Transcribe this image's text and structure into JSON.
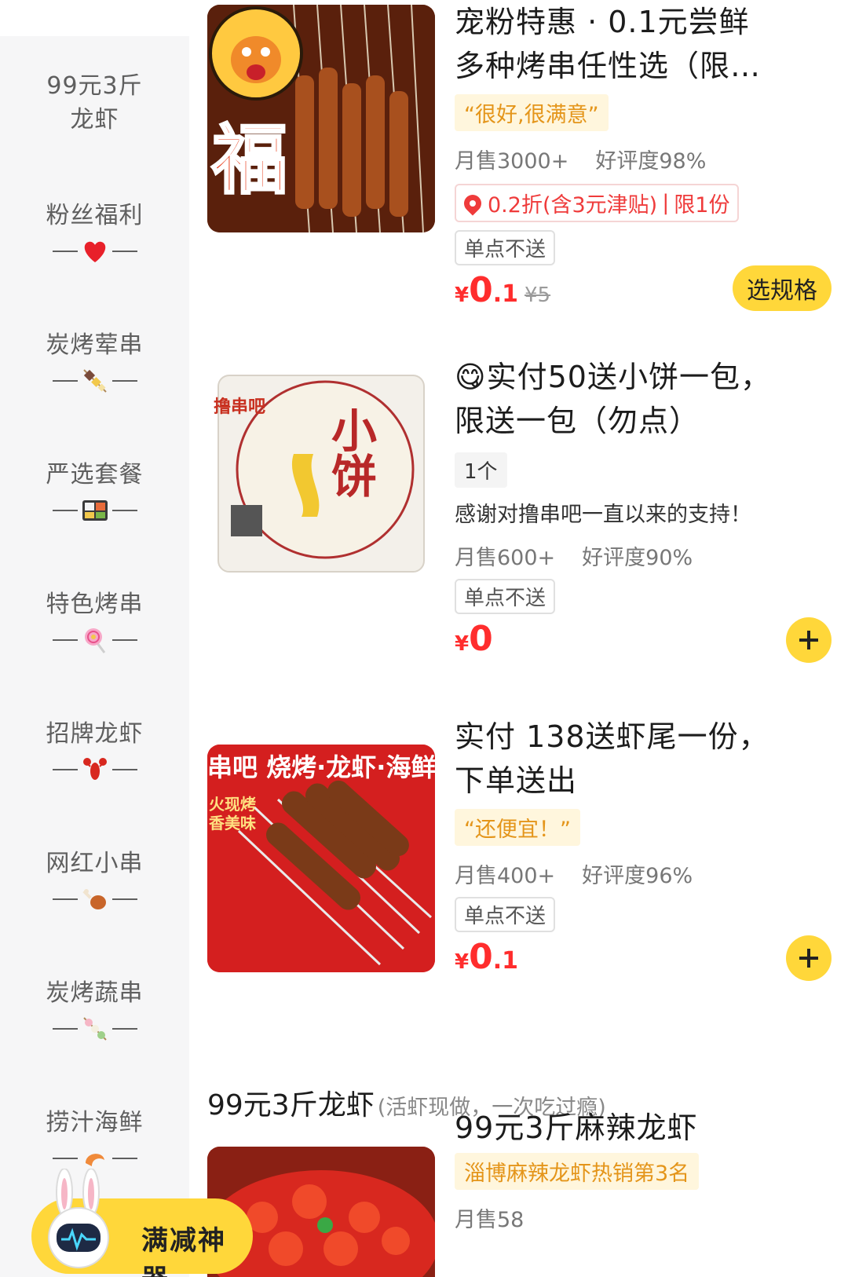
{
  "sidebar": {
    "items": [
      {
        "label_line1": "99元3斤",
        "label_line2": "龙虾",
        "icon": "none"
      },
      {
        "label": "粉丝福利",
        "icon": "heart-icon"
      },
      {
        "label": "炭烤荤串",
        "icon": "meat-skewer-icon"
      },
      {
        "label": "严选套餐",
        "icon": "bento-box-icon"
      },
      {
        "label": "特色烤串",
        "icon": "lollipop-icon"
      },
      {
        "label": "招牌龙虾",
        "icon": "lobster-icon"
      },
      {
        "label": "网红小串",
        "icon": "drumstick-icon"
      },
      {
        "label": "炭烤蔬串",
        "icon": "dango-icon"
      },
      {
        "label": "捞汁海鲜",
        "icon": "shrimp-icon"
      }
    ]
  },
  "products": [
    {
      "title_line1": "宠粉特惠 · 0.1元尝鲜",
      "title_line2": "多种烤串任性选（限…",
      "quote": "“很好,很满意”",
      "monthly_sales": "月售3000+",
      "rating": "好评度98%",
      "promo_discount": "0.2折(含3元津贴)",
      "promo_limit": "限1份",
      "no_delivery": "单点不送",
      "price_currency": "¥",
      "price_int": "0",
      "price_dec": ".1",
      "old_price": "¥5",
      "action": "选规格",
      "image_text": "福"
    },
    {
      "title_line1": "😋实付50送小饼一包，",
      "title_line2": "限送一包（勿点）",
      "unit": "1个",
      "description": "感谢对撸串吧一直以来的支持！",
      "monthly_sales": "月售600+",
      "rating": "好评度90%",
      "no_delivery": "单点不送",
      "price_currency": "¥",
      "price_int": "0",
      "image_brand": "撸串吧",
      "image_text": "小饼"
    },
    {
      "title_line1": "实付 138送虾尾一份，",
      "title_line2": "下单送出",
      "quote": "“还便宜！”",
      "monthly_sales": "月售400+",
      "rating": "好评度96%",
      "no_delivery": "单点不送",
      "price_currency": "¥",
      "price_int": "0",
      "price_dec": ".1",
      "image_banner": "串吧 烧烤·龙虾·海鲜",
      "image_sub": "火现烤 香美味"
    },
    {
      "title": "99元3斤麻辣龙虾",
      "rank_tag": "淄博麻辣龙虾热销第3名",
      "monthly_sales": "月售58"
    }
  ],
  "section": {
    "title": "99元3斤龙虾",
    "subtitle": "(活虾现做，一次吃过瘾)"
  },
  "float_button": {
    "label": "满减神器"
  },
  "colors": {
    "accent_yellow": "#ffd73a",
    "price_red": "#ff2d2d",
    "quote_orange": "#e4951a",
    "sidebar_bg": "#f6f6f7"
  }
}
